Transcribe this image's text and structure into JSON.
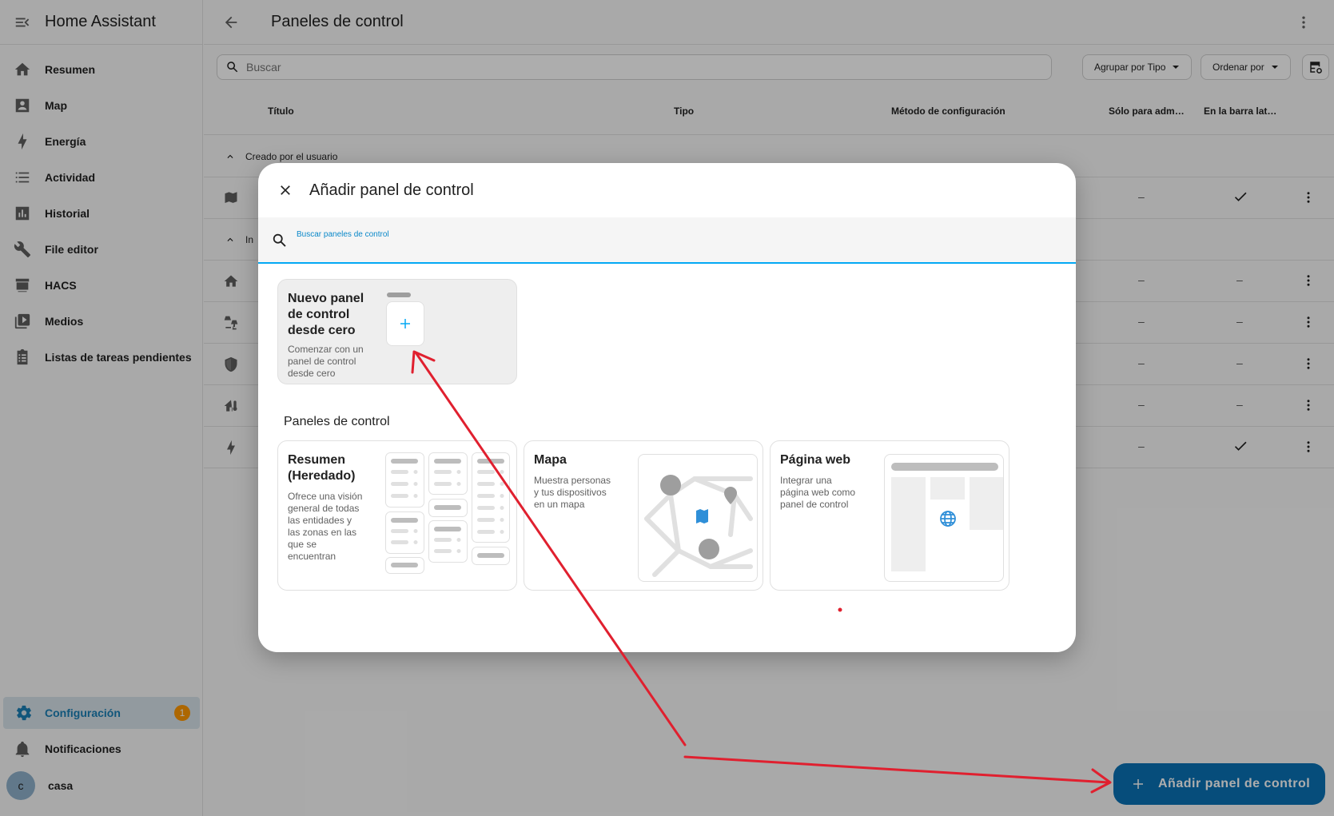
{
  "app": {
    "title": "Home Assistant"
  },
  "sidebar": {
    "items": [
      {
        "label": "Resumen",
        "icon": "home-icon"
      },
      {
        "label": "Map",
        "icon": "map-account-icon"
      },
      {
        "label": "Energía",
        "icon": "lightning-bolt-icon"
      },
      {
        "label": "Actividad",
        "icon": "format-list-bulleted-icon"
      },
      {
        "label": "Historial",
        "icon": "chart-box-icon"
      },
      {
        "label": "File editor",
        "icon": "wrench-icon"
      },
      {
        "label": "HACS",
        "icon": "hacs-icon"
      },
      {
        "label": "Medios",
        "icon": "play-box-multiple-icon"
      },
      {
        "label": "Listas de tareas pendientes",
        "icon": "clipboard-list-icon"
      }
    ],
    "config": {
      "label": "Configuración",
      "badge": "1"
    },
    "notifications": {
      "label": "Notificaciones"
    },
    "user": {
      "initial": "c",
      "name": "casa"
    }
  },
  "page": {
    "title": "Paneles de control",
    "search_placeholder": "Buscar",
    "group_by": "Agrupar por Tipo",
    "sort_by": "Ordenar por",
    "columns": [
      "Título",
      "Tipo",
      "Método de configuración",
      "Sólo para adm…",
      "En la barra lat…"
    ],
    "group_user": "Creado por el usuario",
    "group_builtin": "In",
    "rows": [
      {
        "icon": "map-icon",
        "admin": "–",
        "sidebar": "check"
      },
      {
        "icon": "home-icon",
        "admin": "–",
        "sidebar": "–"
      },
      {
        "icon": "lamps-icon",
        "admin": "–",
        "sidebar": "–"
      },
      {
        "icon": "shield-icon",
        "admin": "–",
        "sidebar": "–"
      },
      {
        "icon": "home-thermometer-icon",
        "admin": "–",
        "sidebar": "–"
      },
      {
        "icon": "lightning-bolt-icon",
        "admin": "–",
        "sidebar": "check"
      }
    ],
    "fab_label": "Añadir panel de control"
  },
  "dialog": {
    "title": "Añadir panel de control",
    "search_label": "Buscar paneles de control",
    "new_card": {
      "title_lines": [
        "Nuevo panel",
        "de control",
        "desde cero"
      ],
      "desc_lines": [
        "Comenzar con un",
        "panel de control",
        "desde cero"
      ]
    },
    "section_title": "Paneles de control",
    "cards": [
      {
        "title_lines": [
          "Resumen",
          "(Heredado)"
        ],
        "desc_lines": [
          "Ofrece una visión",
          "general de todas",
          "las entidades y",
          "las zonas en las",
          "que se",
          "encuentran"
        ]
      },
      {
        "title_lines": [
          "Mapa"
        ],
        "desc_lines": [
          "Muestra personas",
          "y tus dispositivos",
          "en un mapa"
        ]
      },
      {
        "title_lines": [
          "Página web"
        ],
        "desc_lines": [
          "Integrar una",
          "página web como",
          "panel de control"
        ]
      }
    ]
  },
  "colors": {
    "accent": "#03a9f4",
    "fab": "#0a72b5",
    "badge": "#ff9800",
    "annotation_arrow": "#e0202f"
  }
}
